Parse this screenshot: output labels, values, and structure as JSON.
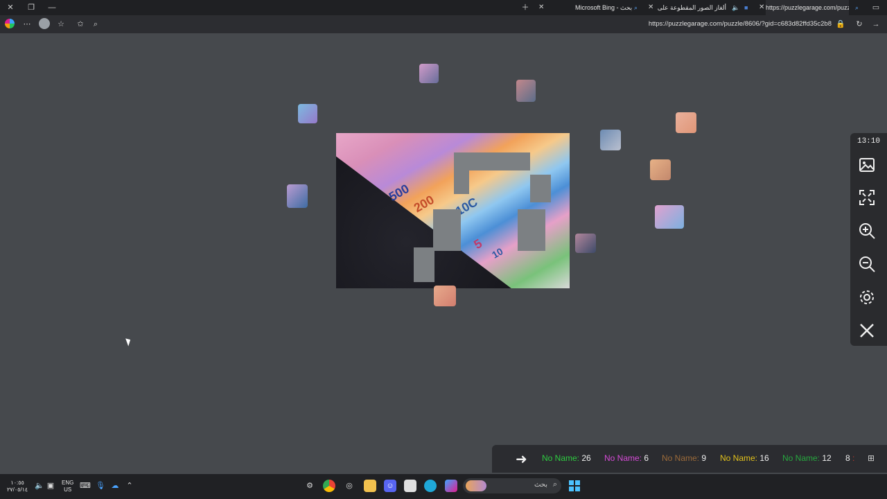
{
  "browser": {
    "tabs": [
      {
        "label": "Microsoft Bing - بحث"
      },
      {
        "label": "ألغاز الصور المقطوعة على الإ"
      },
      {
        "label": "https://puzzlegarage.com/puzzle"
      }
    ],
    "url": "https://puzzlegarage.com/puzzle/8606/?gid=c683d82ffd35c2b8",
    "icons": [
      "close-icon",
      "restore-icon",
      "minimize-icon",
      "new-tab-icon",
      "favorites-icon",
      "more-icon",
      "refresh-icon",
      "lock-icon"
    ]
  },
  "puzzle": {
    "note_values": [
      "500",
      "200",
      "10C",
      "5",
      "10"
    ],
    "colors": {
      "background": "#46494d",
      "gap": "#7c8083"
    }
  },
  "sidepanel": {
    "timer": "13:10",
    "buttons": [
      "image-icon",
      "fullscreen-icon",
      "zoom-in-icon",
      "zoom-out-icon",
      "settings-icon",
      "close-icon"
    ]
  },
  "players": [
    {
      "name": "No Name:",
      "score": "26",
      "color": "#2ecc40"
    },
    {
      "name": "No Name:",
      "score": "6",
      "color": "#d64bd6"
    },
    {
      "name": "No Name:",
      "score": "9",
      "color": "#9c6b3a"
    },
    {
      "name": "No Name:",
      "score": "16",
      "color": "#e3c21b"
    },
    {
      "name": "No Name:",
      "score": "12",
      "color": "#27a83f"
    },
    {
      "name": ":",
      "score": "8",
      "color": "#c0392b"
    }
  ],
  "taskbar": {
    "search_label": "بحث",
    "lang_line1": "ENG",
    "lang_line2": "US",
    "time": "١٠:٥٥",
    "date": "٢٧/٠٥/١٤"
  }
}
